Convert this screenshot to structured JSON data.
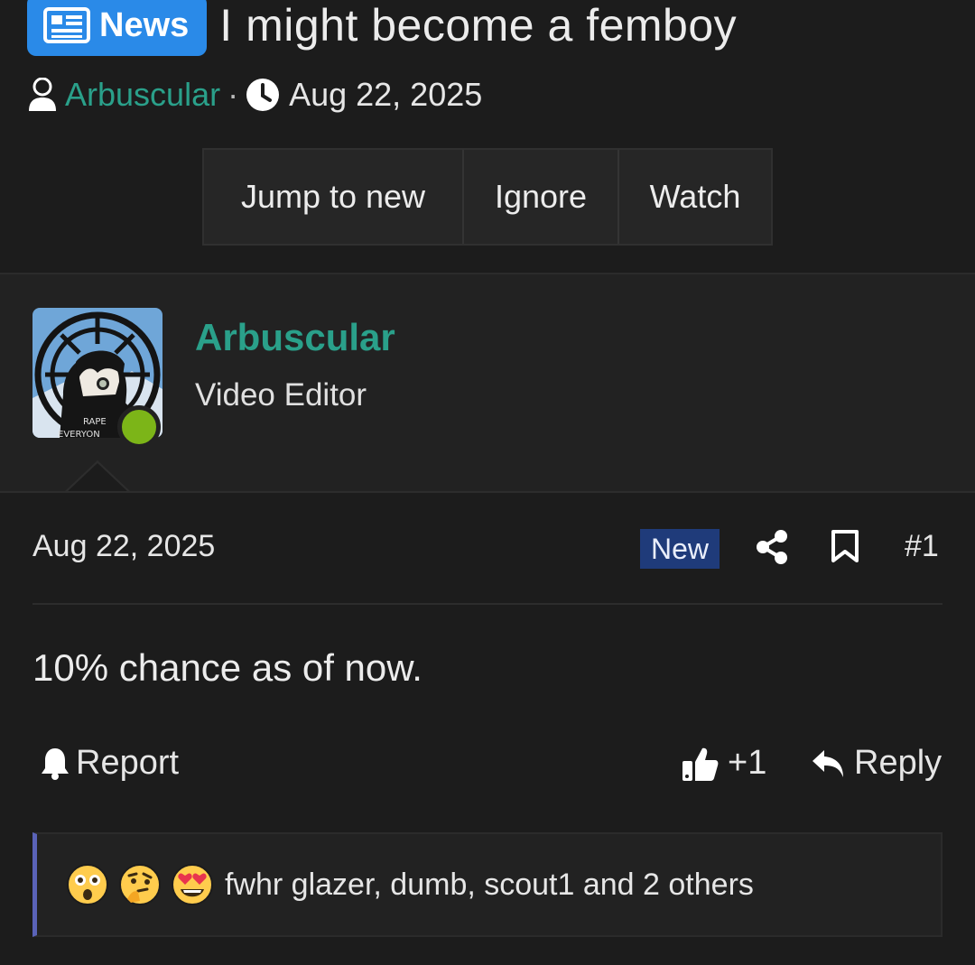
{
  "thread": {
    "prefix": "News",
    "title": "I might become a femboy",
    "author": "Arbuscular",
    "separator": "·",
    "date": "Aug 22, 2025"
  },
  "actions": {
    "jump": "Jump to new",
    "ignore": "Ignore",
    "watch": "Watch"
  },
  "user": {
    "name": "Arbuscular",
    "title": "Video Editor",
    "online": true,
    "avatar_text_1": "RAPE",
    "avatar_text_2": "EVERYON"
  },
  "post": {
    "date": "Aug 22, 2025",
    "new_badge": "New",
    "number": "#1",
    "body": "10% chance as of now.",
    "report": "Report",
    "like_count": "+1",
    "reply": "Reply",
    "reactions": {
      "emojis": [
        "astonished-emoji",
        "thinking-emoji",
        "heart-eyes-emoji"
      ],
      "text": "fwhr glazer, dumb, scout1 and 2 others"
    }
  },
  "colors": {
    "background": "#1c1c1c",
    "accent_link": "#2aa08a",
    "prefix_badge": "#2a8ae8",
    "new_badge": "#1f3b7a",
    "online": "#7cb518",
    "reaction_border": "#5a63b8"
  }
}
